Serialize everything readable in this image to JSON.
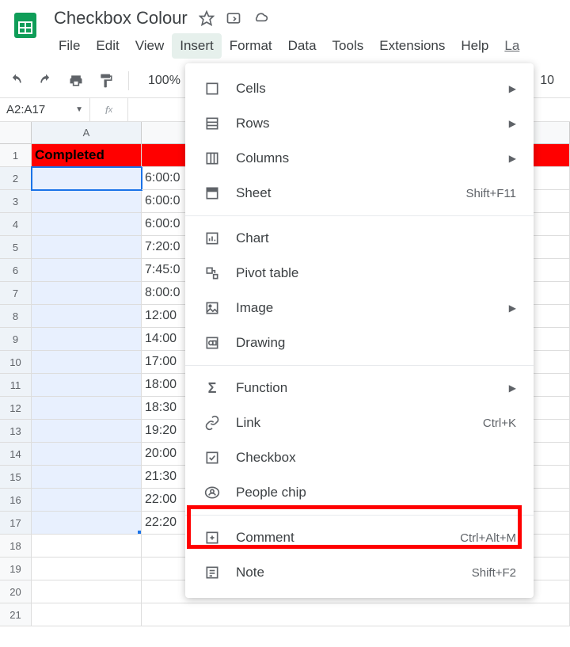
{
  "doc": {
    "title": "Checkbox Colour"
  },
  "menubar": {
    "file": "File",
    "edit": "Edit",
    "view": "View",
    "insert": "Insert",
    "format": "Format",
    "data": "Data",
    "tools": "Tools",
    "extensions": "Extensions",
    "help": "Help",
    "lastupdate": "La"
  },
  "toolbar": {
    "zoom": "100%",
    "fontsize": "10"
  },
  "namebox": "A2:A17",
  "fx_label": "fx",
  "sheet": {
    "col_a_header": "A",
    "header_row": "Completed",
    "row_labels": [
      "1",
      "2",
      "3",
      "4",
      "5",
      "6",
      "7",
      "8",
      "9",
      "10",
      "11",
      "12",
      "13",
      "14",
      "15",
      "16",
      "17",
      "18",
      "19",
      "20",
      "21"
    ],
    "col_b_values": [
      "6:00:0",
      "6:00:0",
      "6:00:0",
      "7:20:0",
      "7:45:0",
      "8:00:0",
      "12:00",
      "14:00",
      "17:00",
      "18:00",
      "18:30",
      "19:20",
      "20:00",
      "21:30",
      "22:00",
      "22:20",
      "",
      "",
      "",
      ""
    ]
  },
  "dropdown": {
    "cells": "Cells",
    "rows": "Rows",
    "columns": "Columns",
    "sheet": "Sheet",
    "sheet_shortcut": "Shift+F11",
    "chart": "Chart",
    "pivot": "Pivot table",
    "image": "Image",
    "drawing": "Drawing",
    "function": "Function",
    "link": "Link",
    "link_shortcut": "Ctrl+K",
    "checkbox": "Checkbox",
    "people": "People chip",
    "comment": "Comment",
    "comment_shortcut": "Ctrl+Alt+M",
    "note": "Note",
    "note_shortcut": "Shift+F2"
  }
}
